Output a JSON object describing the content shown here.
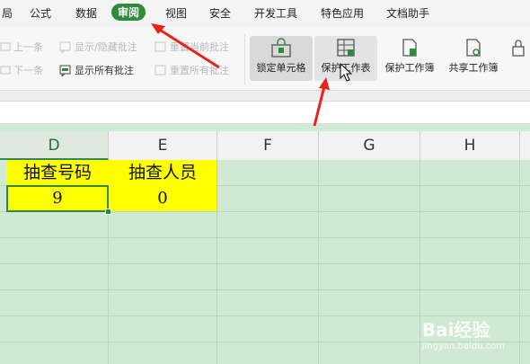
{
  "tabs": [
    {
      "label": "局",
      "active": false
    },
    {
      "label": "公式",
      "active": false
    },
    {
      "label": "数据",
      "active": false
    },
    {
      "label": "审阅",
      "active": true
    },
    {
      "label": "视图",
      "active": false
    },
    {
      "label": "安全",
      "active": false
    },
    {
      "label": "开发工具",
      "active": false
    },
    {
      "label": "特色应用",
      "active": false
    },
    {
      "label": "文档助手",
      "active": false
    }
  ],
  "toolbar": {
    "prev_comment": "上一条",
    "next_comment": "下一条",
    "show_hide_comment": "显示/隐藏批注",
    "show_all_comments": "显示所有批注",
    "reset_current_comment": "重置当前批注",
    "reset_all_comments": "重置所有批注",
    "lock_cell": "锁定单元格",
    "protect_sheet": "保护工作表",
    "protect_workbook": "保护工作簿",
    "share_workbook": "共享工作簿"
  },
  "columns": [
    "D",
    "E",
    "F",
    "G",
    "H"
  ],
  "active_column": "D",
  "cells": {
    "d1": "抽查号码",
    "e1": "抽查人员",
    "d2": "9",
    "e2": "0"
  },
  "watermark": {
    "brand": "Bai经验",
    "url": "jingyan.baidu.com"
  },
  "colors": {
    "accent": "#2f8a3c",
    "highlight": "#ffff00",
    "sheet_bg": "#cfe9d4",
    "annotation_arrow": "#e8231b"
  }
}
